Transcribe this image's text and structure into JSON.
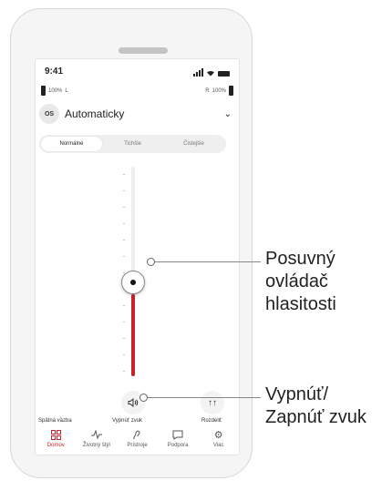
{
  "status_bar": {
    "time": "9:41"
  },
  "hearing_aids": {
    "left": {
      "battery": "100%",
      "side": "L"
    },
    "right": {
      "battery": "100%",
      "side": "R"
    }
  },
  "program": {
    "icon_text": "OS",
    "name": "Automaticky"
  },
  "modes": [
    {
      "label": "Normálne",
      "active": true
    },
    {
      "label": "Tichšie",
      "active": false
    },
    {
      "label": "Čistejšie",
      "active": false
    }
  ],
  "volume": {
    "level": 0.45,
    "accent": "#c8222c"
  },
  "controls": {
    "feedback_label": "Spätná väzba",
    "mute_label": "Vypnúť zvuk",
    "split_label": "Rozdeliť"
  },
  "nav": [
    {
      "label": "Domov",
      "icon": "home-grid-icon",
      "active": true
    },
    {
      "label": "Životný štýl",
      "icon": "activity-icon",
      "active": false
    },
    {
      "label": "Prístroje",
      "icon": "hearing-aid-icon",
      "active": false
    },
    {
      "label": "Podpora",
      "icon": "chat-bubble-icon",
      "active": false
    },
    {
      "label": "Viac",
      "icon": "gear-icon",
      "active": false
    }
  ],
  "callouts": {
    "slider": "Posuvný\novládač\nhlasitosti",
    "mute": "Vypnúť/\nZapnúť zvuk"
  }
}
